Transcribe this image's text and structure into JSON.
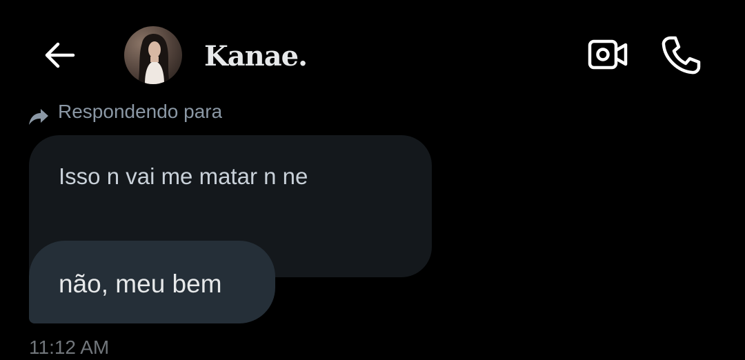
{
  "header": {
    "back_icon": "arrow-left-icon",
    "contact_name": "Kanae.",
    "video_call_icon": "video-camera-icon",
    "voice_call_icon": "phone-icon"
  },
  "thread": {
    "reply_context": {
      "icon": "reply-arrow-icon",
      "label": "Respondendo para"
    },
    "quoted_message": {
      "text": "Isso n vai me matar n ne"
    },
    "reply_message": {
      "text": "não, meu bem",
      "timestamp": "11:12 AM"
    }
  },
  "colors": {
    "background": "#000000",
    "quoted_bubble": "#14181c",
    "reply_bubble": "#252f38",
    "primary_text": "#e7e9ea",
    "secondary_text": "#71767b"
  }
}
